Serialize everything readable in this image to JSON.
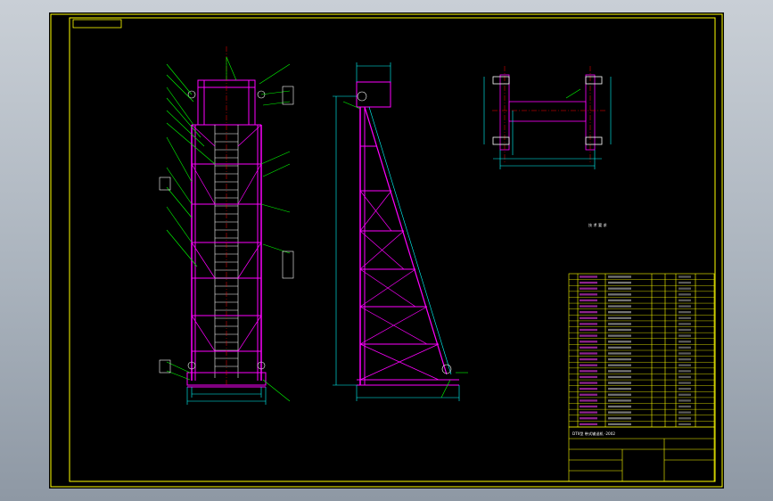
{
  "drawing": {
    "tag_label": "",
    "section_label": "",
    "tech_req_title": "技 术 要 求",
    "tech_req_lines": [
      "",
      "",
      "",
      "",
      ""
    ],
    "title_main": "DTII型 带式输送机 ·2002",
    "title_scale_label": "",
    "title_name_label": ""
  },
  "colors": {
    "sheet_background": "#000000",
    "border": "#ffff00",
    "primary_lines": "#ff00ff",
    "leader_lines": "#00ff00",
    "dimension_lines": "#00ffff",
    "center_lines": "#ff0000",
    "text": "#ffffff"
  },
  "parts_table": {
    "row_count": 26,
    "rows": []
  }
}
